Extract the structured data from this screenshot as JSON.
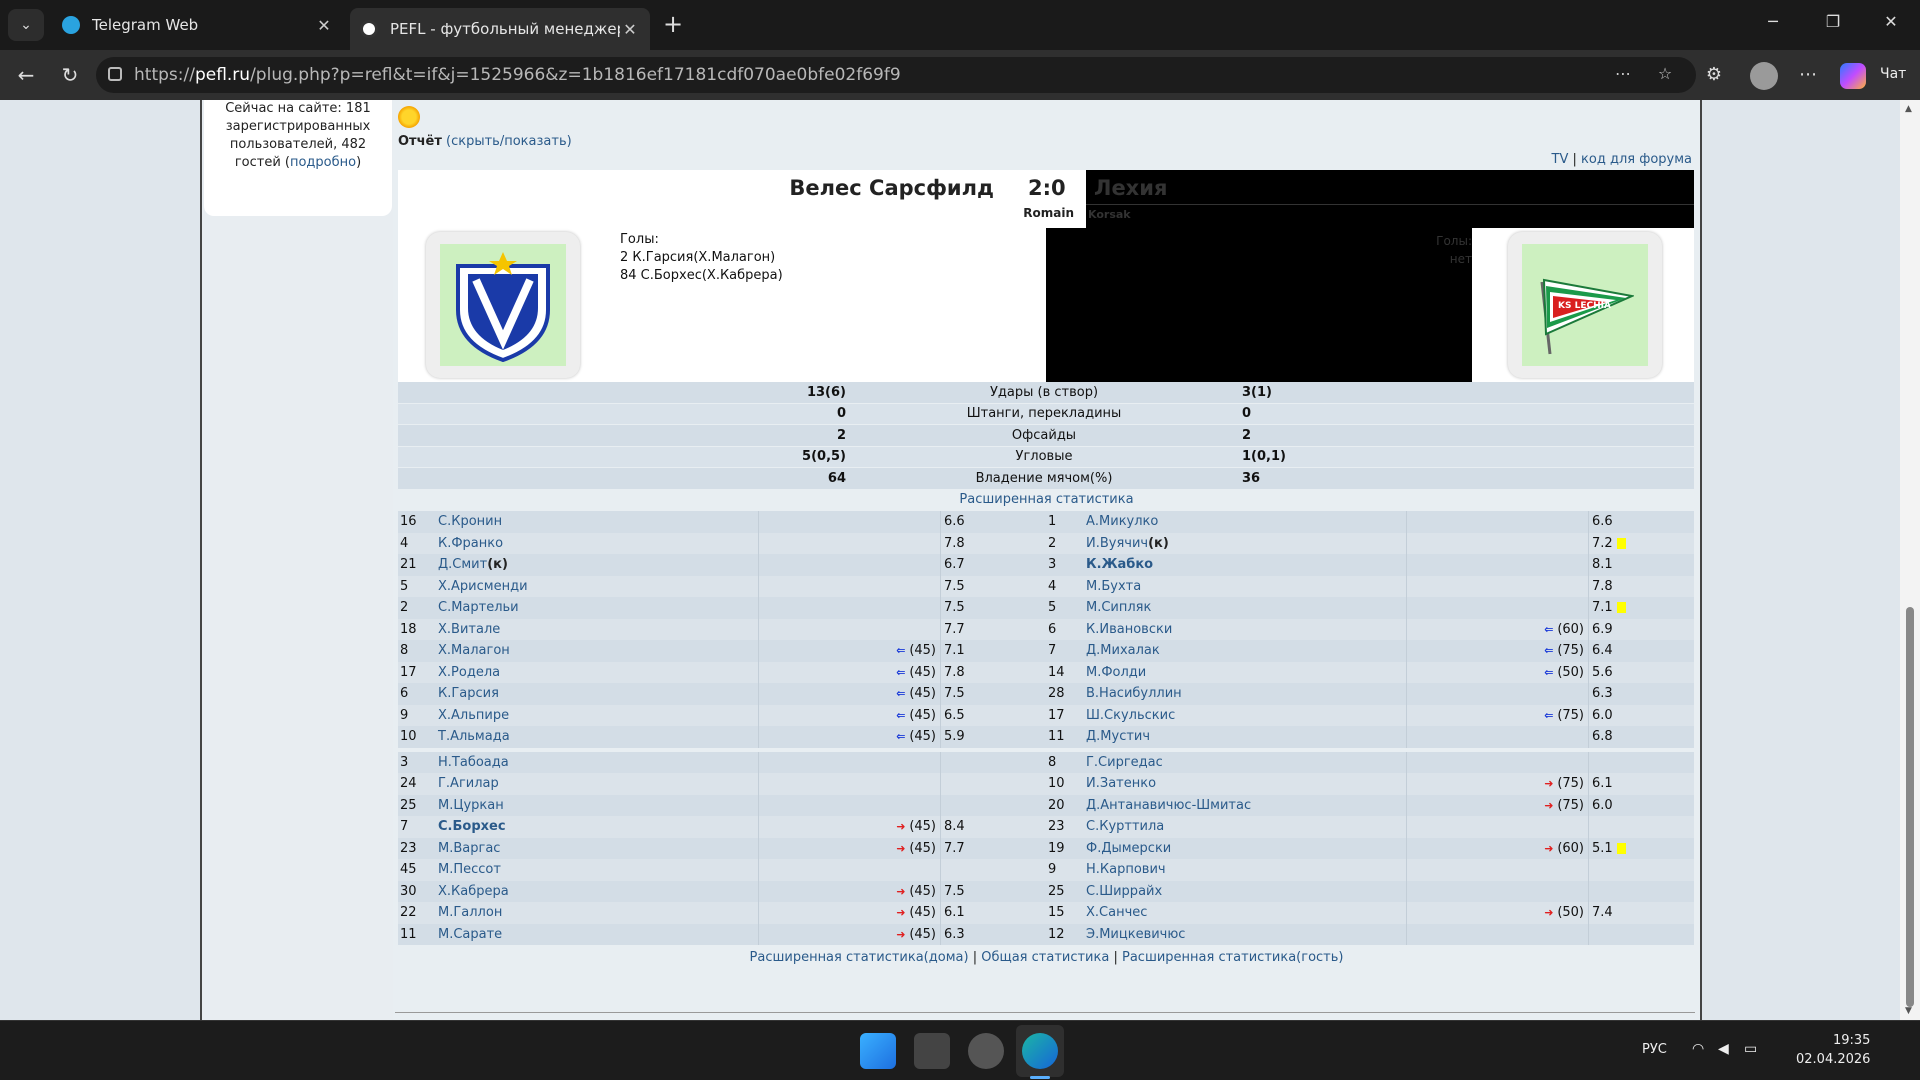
{
  "browser": {
    "tabs": [
      {
        "title": "Telegram Web",
        "active": false
      },
      {
        "title": "PEFL - футбольный менеджер он",
        "active": true
      }
    ],
    "url_prefix": "https://",
    "url_domain": "pefl.ru",
    "url_rest": "/plug.php?p=refl&t=if&j=1525966&z=1b1816ef17181cdf070ae0bfe02f69f9",
    "chat_label": "Чат"
  },
  "sidebar": {
    "online_line1": "Сейчас на сайте: 181",
    "online_line2": "зарегистрированных",
    "online_line3": "пользователей, 482",
    "online_line4": "гостей (",
    "online_link": "подробно",
    "online_end": ")"
  },
  "report": {
    "label": "Отчёт",
    "toggle": "(скрыть/показать)",
    "tv": "TV",
    "sep": "|",
    "forum_code": "код для форума"
  },
  "match": {
    "home_name": "Велес Сарсфилд",
    "score": "2:0",
    "away_name": "Лехия",
    "home_coach": "Romain",
    "away_coach": "Korsak",
    "home_goals_title": "Голы:",
    "home_goals": [
      "2 К.Гарсия(Х.Малагон)",
      "84 С.Борхес(Х.Кабрера)"
    ],
    "away_goals_title": "Голы:",
    "away_goals": [
      "нет"
    ],
    "away_logo_text": "KS LECHIA"
  },
  "stats": [
    {
      "home": "13(6)",
      "label": "Удары (в створ)",
      "away": "3(1)"
    },
    {
      "home": "0",
      "label": "Штанги, перекладины",
      "away": "0"
    },
    {
      "home": "2",
      "label": "Офсайды",
      "away": "2"
    },
    {
      "home": "5(0,5)",
      "label": "Угловые",
      "away": "1(0,1)"
    },
    {
      "home": "64",
      "label": "Владение мячом(%)",
      "away": "36"
    }
  ],
  "extended_stats_link": "Расширенная статистика",
  "lineup_starters": [
    {
      "hn": "16",
      "hp": "С.Кронин",
      "hs": "",
      "hr": "6.6",
      "an": "1",
      "ap": "А.Микулко",
      "as": "",
      "ar": "6.6"
    },
    {
      "hn": "4",
      "hp": "К.Франко",
      "hs": "",
      "hr": "7.8",
      "an": "2",
      "ap": "И.Вуячич",
      "acap": "(к)",
      "as": "",
      "ar": "7.2",
      "ay": true
    },
    {
      "hn": "21",
      "hp": "Д.Смит",
      "hcap": "(к)",
      "hs": "",
      "hr": "6.7",
      "an": "3",
      "ap": "К.Жабко",
      "abold": true,
      "as": "",
      "ar": "8.1"
    },
    {
      "hn": "5",
      "hp": "Х.Арисменди",
      "hs": "",
      "hr": "7.5",
      "an": "4",
      "ap": "М.Бухта",
      "as": "",
      "ar": "7.8"
    },
    {
      "hn": "2",
      "hp": "С.Мартельи",
      "hs": "",
      "hr": "7.5",
      "an": "5",
      "ap": "М.Сипляк",
      "as": "",
      "ar": "7.1",
      "ay": true
    },
    {
      "hn": "18",
      "hp": "Х.Витале",
      "hs": "",
      "hr": "7.7",
      "an": "6",
      "ap": "К.Ивановски",
      "as": "(60)",
      "ar": "6.9"
    },
    {
      "hn": "8",
      "hp": "Х.Малагон",
      "hs": "(45)",
      "hr": "7.1",
      "an": "7",
      "ap": "Д.Михалак",
      "as": "(75)",
      "ar": "6.4"
    },
    {
      "hn": "17",
      "hp": "Х.Родела",
      "hs": "(45)",
      "hr": "7.8",
      "an": "14",
      "ap": "М.Фолди",
      "as": "(50)",
      "ar": "5.6"
    },
    {
      "hn": "6",
      "hp": "К.Гарсия",
      "hs": "(45)",
      "hr": "7.5",
      "an": "28",
      "ap": "В.Насибуллин",
      "as": "",
      "ar": "6.3"
    },
    {
      "hn": "9",
      "hp": "Х.Альпире",
      "hs": "(45)",
      "hr": "6.5",
      "an": "17",
      "ap": "Ш.Скульскис",
      "as": "(75)",
      "ar": "6.0"
    },
    {
      "hn": "10",
      "hp": "Т.Альмада",
      "hs": "(45)",
      "hr": "5.9",
      "an": "11",
      "ap": "Д.Мустич",
      "as": "",
      "ar": "6.8"
    }
  ],
  "lineup_subs": [
    {
      "hn": "3",
      "hp": "Н.Табоада",
      "hs": "",
      "hr": "",
      "an": "8",
      "ap": "Г.Сиргедас",
      "as": "",
      "ar": ""
    },
    {
      "hn": "24",
      "hp": "Г.Агилар",
      "hs": "",
      "hr": "",
      "an": "10",
      "ap": "И.Затенко",
      "as": "(75)",
      "ar": "6.1"
    },
    {
      "hn": "25",
      "hp": "М.Цуркан",
      "hs": "",
      "hr": "",
      "an": "20",
      "ap": "Д.Антанавичюс-Шмитас",
      "as": "(75)",
      "ar": "6.0"
    },
    {
      "hn": "7",
      "hp": "С.Борхес",
      "hbold": true,
      "hs": "(45)",
      "hr": "8.4",
      "an": "23",
      "ap": "С.Курттила",
      "as": "",
      "ar": ""
    },
    {
      "hn": "23",
      "hp": "М.Варгас",
      "hs": "(45)",
      "hr": "7.7",
      "an": "19",
      "ap": "Ф.Дымерски",
      "as": "(60)",
      "ar": "5.1",
      "ay": true
    },
    {
      "hn": "45",
      "hp": "М.Пессот",
      "hs": "",
      "hr": "",
      "an": "9",
      "ap": "Н.Карпович",
      "as": "",
      "ar": ""
    },
    {
      "hn": "30",
      "hp": "Х.Кабрера",
      "hs": "(45)",
      "hr": "7.5",
      "an": "25",
      "ap": "С.Ширрайх",
      "as": "",
      "ar": ""
    },
    {
      "hn": "22",
      "hp": "М.Галлон",
      "hs": "(45)",
      "hr": "6.1",
      "an": "15",
      "ap": "Х.Санчес",
      "as": "(50)",
      "ar": "7.4"
    },
    {
      "hn": "11",
      "hp": "М.Сарате",
      "hs": "(45)",
      "hr": "6.3",
      "an": "12",
      "ap": "Э.Мицкевичюс",
      "as": "",
      "ar": ""
    }
  ],
  "footer": {
    "link1": "Расширенная статистика(дома)",
    "link2": "Общая статистика",
    "link3": "Расширенная статистика(гость)",
    "sep": "|"
  },
  "taskbar": {
    "lang": "РУС",
    "time": "19:35",
    "date": "02.04.2026"
  },
  "colors": {
    "link": "#2a5a8a",
    "yellow_card": "#ffff00",
    "sub_in_arrow": "#1a3ad8",
    "sub_out_arrow": "#e02020"
  }
}
